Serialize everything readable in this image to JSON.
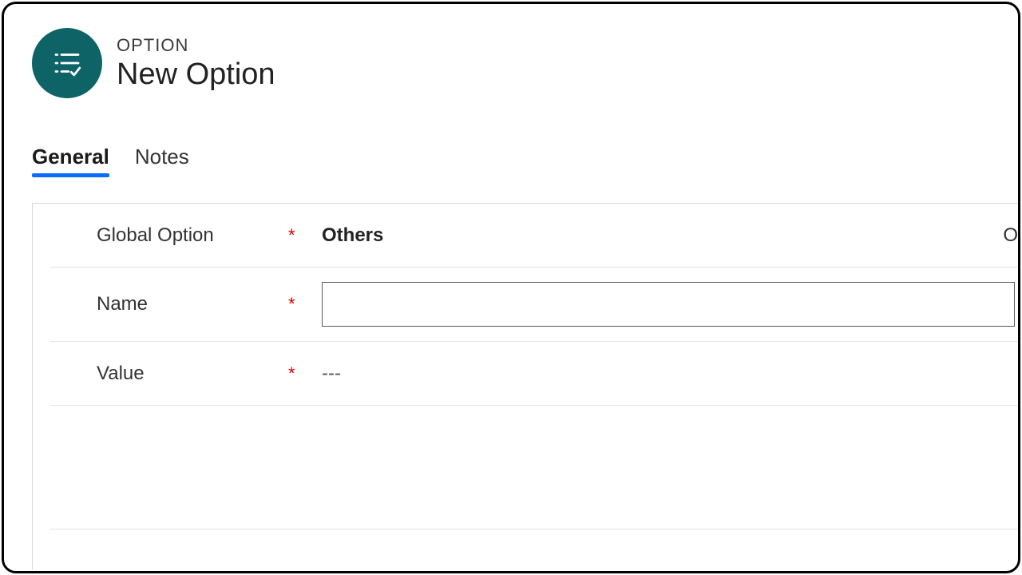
{
  "header": {
    "eyebrow": "OPTION",
    "title": "New Option"
  },
  "tabs": [
    {
      "label": "General",
      "active": true
    },
    {
      "label": "Notes",
      "active": false
    }
  ],
  "form": {
    "global_option": {
      "label": "Global Option",
      "required_marker": "*",
      "value": "Others",
      "trailing": "O"
    },
    "name": {
      "label": "Name",
      "required_marker": "*",
      "value": ""
    },
    "value_field": {
      "label": "Value",
      "required_marker": "*",
      "value": "---"
    }
  }
}
